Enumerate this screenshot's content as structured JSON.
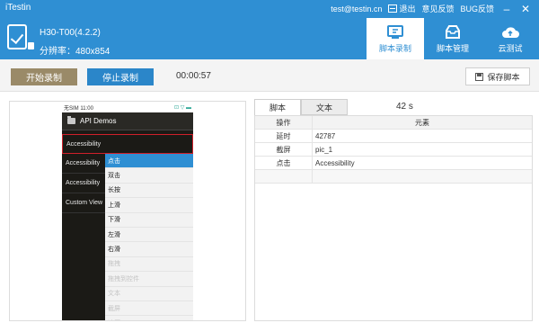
{
  "app": {
    "title": "iTestin"
  },
  "account": {
    "email": "test@testin.cn",
    "logout_label": "退出",
    "feedback_label": "意见反馈",
    "bug_label": "BUG反馈",
    "minimize": "–",
    "close": "✕"
  },
  "device": {
    "name": "H30-T00(4.2.2)",
    "resolution": "分辨率：480x854"
  },
  "nav": {
    "tabs": [
      {
        "label": "脚本录制",
        "icon": "monitor-icon"
      },
      {
        "label": "脚本管理",
        "icon": "tray-icon"
      },
      {
        "label": "云测试",
        "icon": "cloud-icon"
      }
    ]
  },
  "toolbar": {
    "start_label": "开始录制",
    "stop_label": "停止录制",
    "timer": "00:00:57",
    "save_label": "保存脚本"
  },
  "phone": {
    "status_left": "无SIM  11:00",
    "status_right": "⊡ ▽ ▬",
    "app_title": "API Demos",
    "list": [
      "Accessibility",
      "Accessibility",
      "Accessibility",
      "Custom View"
    ],
    "menu": [
      {
        "label": "点击",
        "state": "selected"
      },
      {
        "label": "双击",
        "state": "normal"
      },
      {
        "label": "长按",
        "state": "normal"
      },
      {
        "label": "上滑",
        "state": "normal"
      },
      {
        "label": "下滑",
        "state": "normal"
      },
      {
        "label": "左滑",
        "state": "normal"
      },
      {
        "label": "右滑",
        "state": "normal"
      },
      {
        "label": "拖拽",
        "state": "disabled"
      },
      {
        "label": "拖拽到控件",
        "state": "disabled"
      },
      {
        "label": "文本",
        "state": "disabled"
      },
      {
        "label": "截屏",
        "state": "disabled"
      },
      {
        "label": "遍历",
        "state": "disabled"
      }
    ]
  },
  "script": {
    "tabs": [
      "脚本",
      "文本"
    ],
    "duration": "42 s",
    "columns": [
      "操作",
      "元素"
    ],
    "rows": [
      {
        "op": "延时",
        "el": "42787"
      },
      {
        "op": "截屏",
        "el": "pic_1"
      },
      {
        "op": "点击",
        "el": "Accessibility"
      }
    ]
  }
}
